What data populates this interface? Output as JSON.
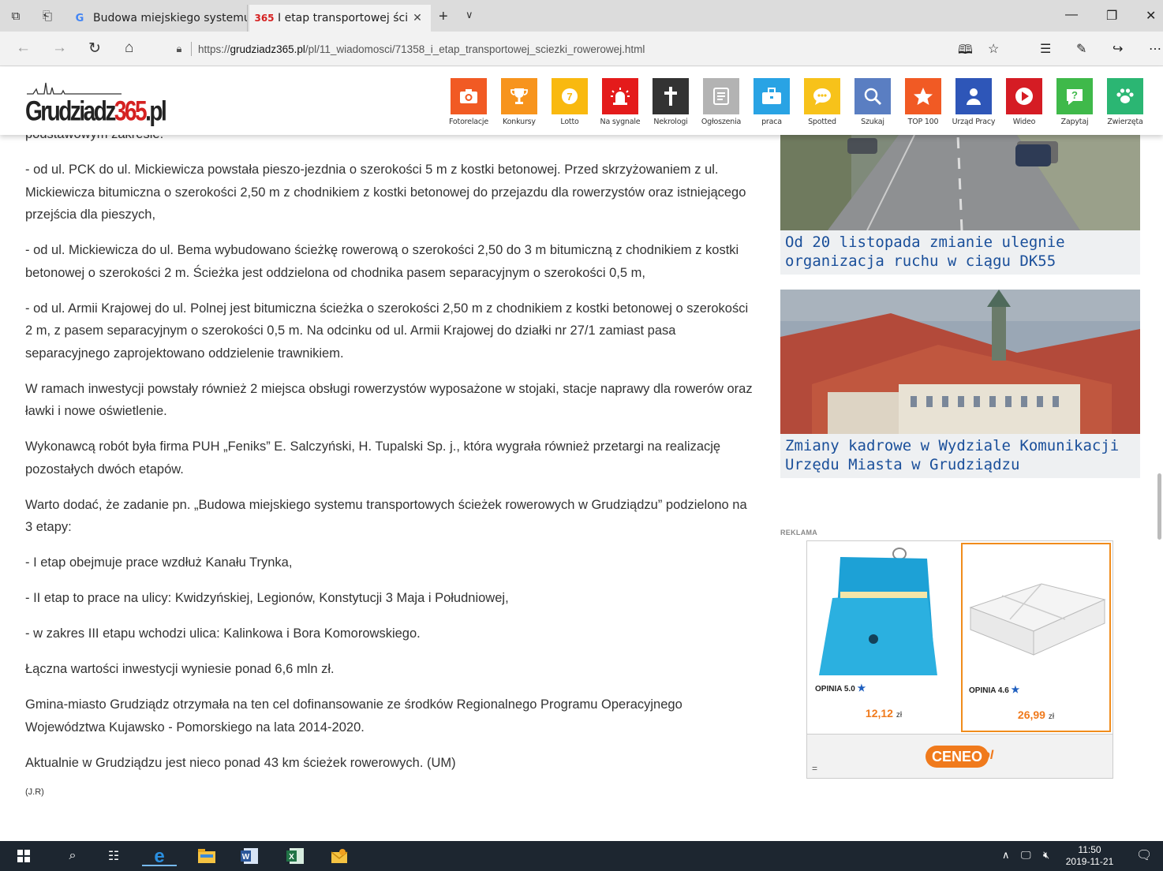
{
  "browser": {
    "tabs": [
      {
        "title": "Budowa miejskiego systemu",
        "favicon": "G"
      },
      {
        "title": "I etap transportowej ści",
        "favicon": "365"
      }
    ],
    "url_prefix": "https://",
    "url_host": "grudziadz365.pl",
    "url_path": "/pl/11_wiadomosci/71358_i_etap_transportowej_sciezki_rowerowej.html"
  },
  "site": {
    "logo_text": "Grudziadz",
    "logo_num": "365",
    "logo_suffix": ".pl",
    "icons": [
      {
        "label": "Fotorelacje",
        "color": "#f15a24",
        "glyph": "camera-icon"
      },
      {
        "label": "Konkursy",
        "color": "#f7941d",
        "glyph": "trophy-icon"
      },
      {
        "label": "Lotto",
        "color": "#f9b90f",
        "glyph": "lotto-ball-icon"
      },
      {
        "label": "Na sygnale",
        "color": "#e41b1b",
        "glyph": "siren-icon"
      },
      {
        "label": "Nekrologi",
        "color": "#333333",
        "glyph": "cross-icon"
      },
      {
        "label": "Ogłoszenia",
        "color": "#b3b3b3",
        "glyph": "notice-icon"
      },
      {
        "label": "praca",
        "color": "#29a3e4",
        "glyph": "briefcase-icon"
      },
      {
        "label": "Spotted",
        "color": "#f7c21a",
        "glyph": "chat-icon"
      },
      {
        "label": "Szukaj",
        "color": "#5a7ec2",
        "glyph": "search-icon"
      },
      {
        "label": "TOP 100",
        "color": "#f15a24",
        "glyph": "star-icon"
      },
      {
        "label": "Urząd Pracy",
        "color": "#2e56b8",
        "glyph": "person-icon"
      },
      {
        "label": "Wideo",
        "color": "#d51c24",
        "glyph": "play-icon"
      },
      {
        "label": "Zapytaj",
        "color": "#3fb94a",
        "glyph": "question-icon"
      },
      {
        "label": "Zwierzęta",
        "color": "#2bb673",
        "glyph": "paw-icon"
      }
    ]
  },
  "article": {
    "paragraphs": [
      "podstawowym zakresie:",
      "- od ul. PCK do ul. Mickiewicza powstała pieszo-jezdnia o szerokości 5 m z kostki betonowej. Przed skrzyżowaniem z ul. Mickiewicza bitumiczna o szerokości 2,50 m z chodnikiem z kostki betonowej do przejazdu dla rowerzystów oraz istniejącego przejścia dla pieszych,",
      "- od ul. Mickiewicza do ul. Bema wybudowano ścieżkę rowerową o szerokości 2,50 do 3 m bitumiczną z chodnikiem z kostki betonowej o szerokości 2 m. Ścieżka jest oddzielona od chodnika pasem separacyjnym o szerokości 0,5 m,",
      "- od ul. Armii Krajowej do ul. Polnej jest bitumiczna ścieżka o szerokości 2,50 m z chodnikiem z kostki betonowej o szerokości 2 m, z pasem separacyjnym o szerokości 0,5 m. Na odcinku od ul. Armii Krajowej do działki nr 27/1 zamiast pasa separacyjnego zaprojektowano oddzielenie trawnikiem.",
      "W ramach inwestycji powstały również 2 miejsca obsługi rowerzystów wyposażone w stojaki, stacje naprawy dla rowerów oraz ławki i nowe oświetlenie.",
      "Wykonawcą robót była firma PUH „Feniks” E. Salczyński, H. Tupalski Sp. j., która wygrała również przetargi na realizację pozostałych dwóch etapów.",
      "Warto dodać, że zadanie pn. „Budowa miejskiego systemu transportowych ścieżek rowerowych w Grudziądzu” podzielono na 3 etapy:",
      "- I etap obejmuje prace wzdłuż Kanału Trynka,",
      "- II etap to prace na ulicy: Kwidzyńskiej, Legionów, Konstytucji 3 Maja i Południowej,",
      "- w zakres III etapu wchodzi ulica: Kalinkowa i Bora Komorowskiego.",
      "Łączna wartości inwestycji wyniesie ponad 6,6 mln zł.",
      "Gmina-miasto Grudziądz otrzymała na ten cel dofinansowanie ze środków Regionalnego Programu Operacyjnego Województwa Kujawsko - Pomorskiego na lata 2014-2020.",
      "Aktualnie w Grudziądzu jest nieco ponad 43 km ścieżek rowerowych. (UM)"
    ],
    "signature": "(J.R)"
  },
  "sidebar": {
    "news": [
      {
        "caption": "Od 20 listopada zmianie ulegnie organizacja ruchu w ciągu DK55"
      },
      {
        "caption": "Zmiany kadrowe w Wydziale Komunikacji Urzędu Miasta w Grudziądzu"
      }
    ],
    "ad_label": "REKLAMA",
    "products": [
      {
        "rating": "OPINIA 5.0",
        "price": "12,12",
        "currency": "zł"
      },
      {
        "rating": "OPINIA 4.6",
        "price": "26,99",
        "currency": "zł"
      }
    ],
    "ceneo": "CENEO",
    "ceneo_pl": "pl",
    "ceneo_menu": "="
  },
  "taskbar": {
    "time": "11:50",
    "date": "2019-11-21"
  }
}
